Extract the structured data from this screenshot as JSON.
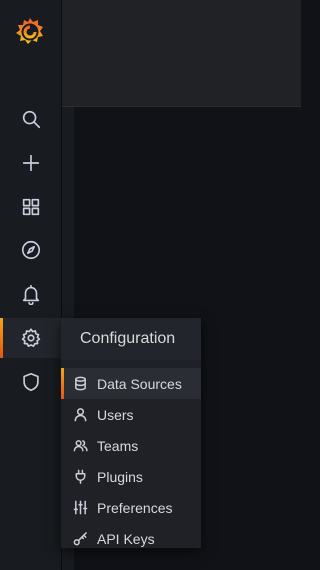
{
  "sidebar": {
    "logo_icon": "grafana-logo-icon",
    "items": [
      {
        "name": "search",
        "icon": "search-icon"
      },
      {
        "name": "create",
        "icon": "plus-icon"
      },
      {
        "name": "dashboards",
        "icon": "grid-icon"
      },
      {
        "name": "explore",
        "icon": "compass-icon"
      },
      {
        "name": "alerting",
        "icon": "bell-icon"
      },
      {
        "name": "configuration",
        "icon": "gear-icon",
        "active": true
      },
      {
        "name": "server-admin",
        "icon": "shield-icon"
      }
    ]
  },
  "config_menu": {
    "title": "Configuration",
    "items": [
      {
        "label": "Data Sources",
        "icon": "database-icon",
        "active": true
      },
      {
        "label": "Users",
        "icon": "user-icon"
      },
      {
        "label": "Teams",
        "icon": "users-icon"
      },
      {
        "label": "Plugins",
        "icon": "plug-icon"
      },
      {
        "label": "Preferences",
        "icon": "sliders-icon"
      },
      {
        "label": "API Keys",
        "icon": "key-icon"
      }
    ]
  },
  "colors": {
    "accent_start": "#f2a51a",
    "accent_end": "#e8560f",
    "sidebar_bg": "#181b1f",
    "menu_bg": "#1f2126",
    "text": "#d8d9da"
  }
}
